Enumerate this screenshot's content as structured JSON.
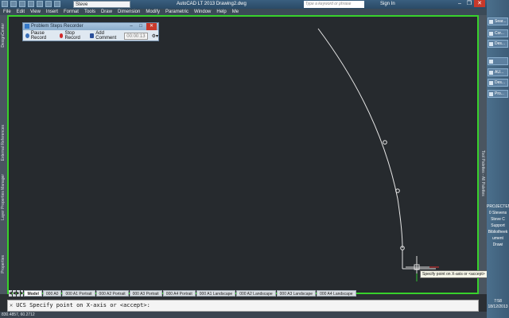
{
  "titlebar": {
    "workspace": "Steve",
    "title": "AutoCAD LT 2013    Drawing2.dwg",
    "search_placeholder": "Type a keyword or phrase",
    "signin": "Sign In"
  },
  "menu": [
    "File",
    "Edit",
    "View",
    "Insert",
    "Format",
    "Tools",
    "Draw",
    "Dimension",
    "Modify",
    "Parametric",
    "Window",
    "Help",
    "Me"
  ],
  "left_palette": {
    "design_center": "DesignCenter",
    "external_refs": "External References",
    "layer_props": "Layer Properties Manager",
    "properties": "Properties"
  },
  "right_palette": {
    "tool_palettes": "Tool Palettes - All Palettes"
  },
  "psr": {
    "title": "Problem Steps Recorder",
    "pause": "Pause Record",
    "stop": "Stop Record",
    "add_comment": "Add Comment",
    "timer": "00:00:13"
  },
  "tooltip": "Specify point on X-axis or <accept>",
  "tabs": [
    "Model",
    "000 A0",
    "000 A1 Portrait",
    "000 A2 Portrait",
    "000 A3 Portrait",
    "000 A4 Portrait",
    "000 A1 Landscape",
    "000 A2 Landscape",
    "000 A3 Landscape",
    "000 A4 Landscape"
  ],
  "command": "UCS Specify point on X-axis or <accept>:",
  "status_coords": "830.4857, 60.2712",
  "taskbar": {
    "items": [
      "Sear...",
      "Cor...",
      "Des...",
      "",
      "AU...",
      "Des...",
      "Pro..."
    ],
    "side": [
      "PROJECTEN",
      "0 Stevens",
      "Steve C",
      "Support",
      "Bibliotheek",
      "ument Drawi"
    ],
    "time": "7:58",
    "date": "18/12/2013"
  },
  "colors": {
    "frame": "#38d12c",
    "canvas": "#262a2e",
    "curve": "#e6e6e6"
  }
}
